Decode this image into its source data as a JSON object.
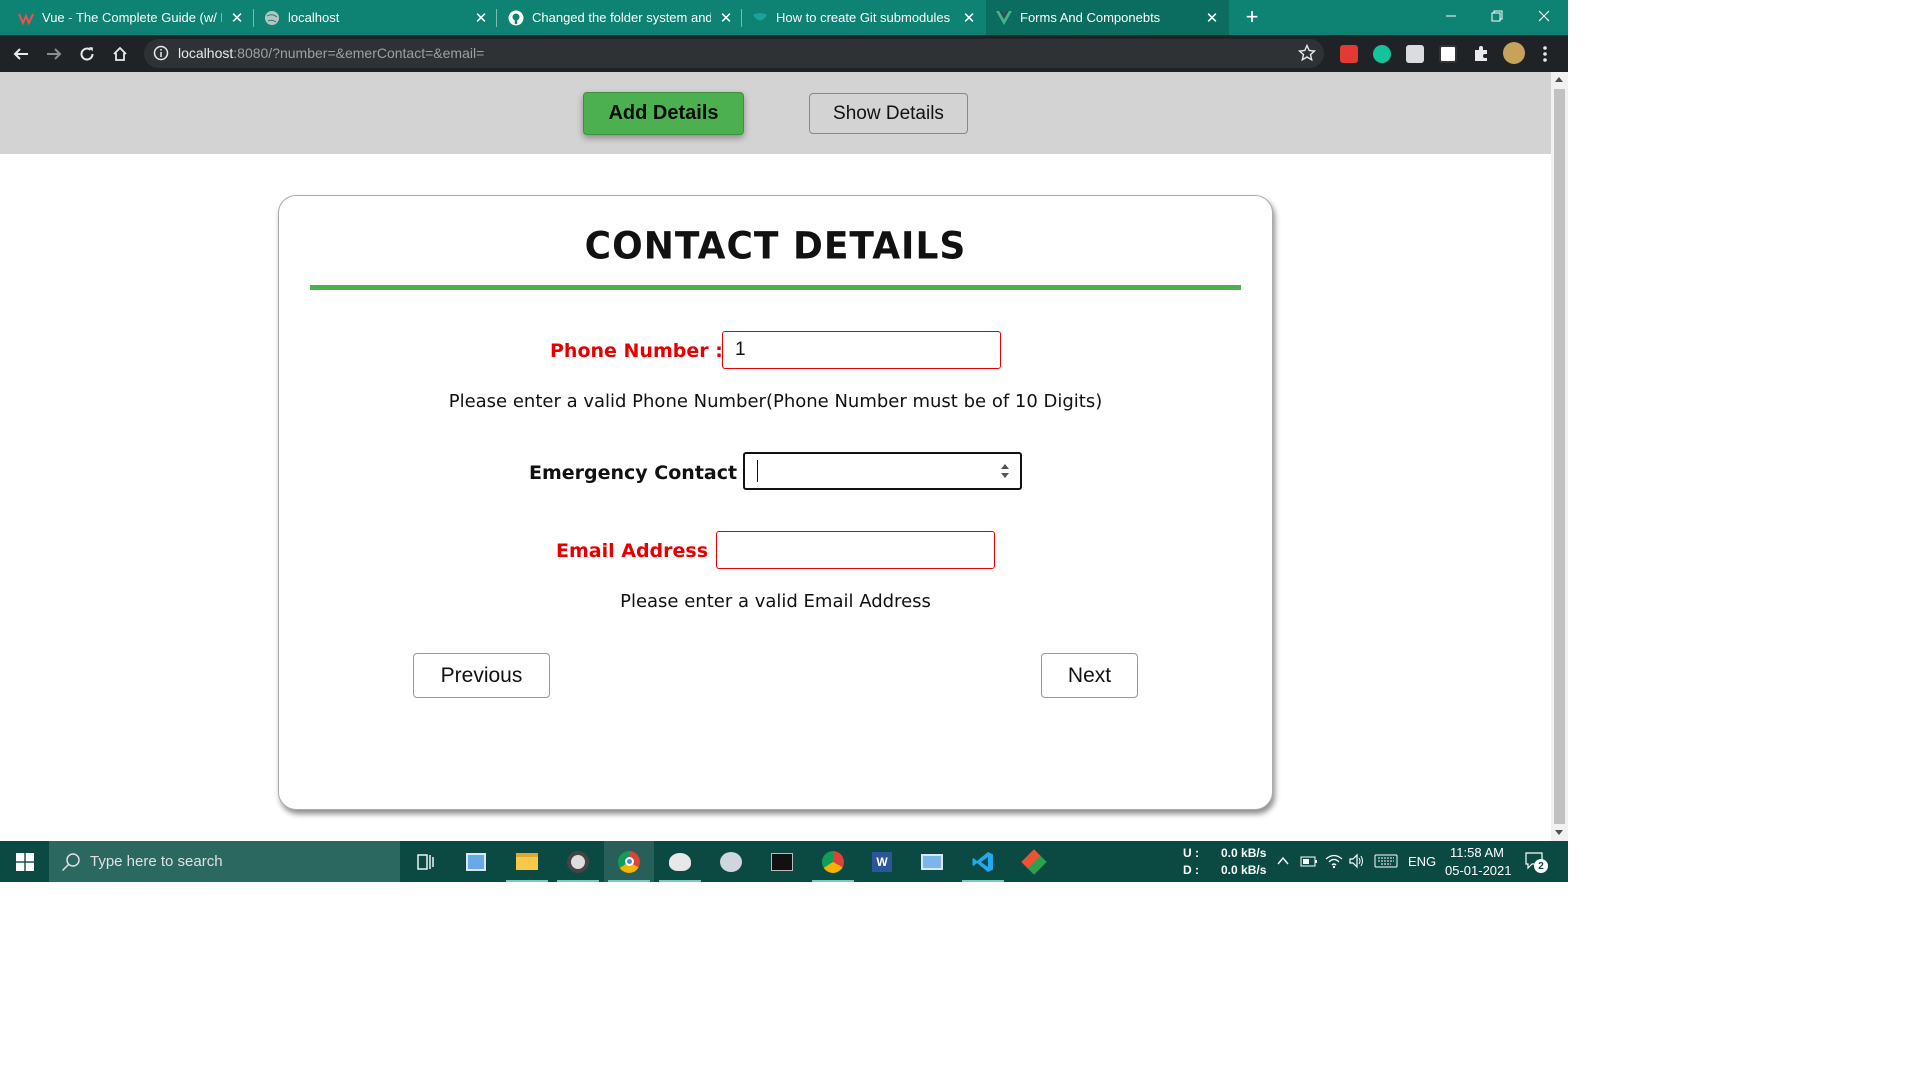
{
  "browser": {
    "tabs": [
      {
        "title": "Vue - The Complete Guide (w/ R",
        "favicon": "udemy-icon",
        "active": false
      },
      {
        "title": "localhost",
        "favicon": "globe-icon",
        "active": false
      },
      {
        "title": "Changed the folder system and a",
        "favicon": "github-icon",
        "active": false
      },
      {
        "title": "How to create Git submodules in",
        "favicon": "site-icon",
        "active": false
      },
      {
        "title": "Forms And Componebts",
        "favicon": "vue-icon",
        "active": true
      }
    ],
    "url_host": "localhost",
    "url_rest": ":8080/?number=&emerContact=&email="
  },
  "app": {
    "add_details_label": "Add Details",
    "show_details_label": "Show Details",
    "title": "CONTACT DETAILS",
    "phone": {
      "label": "Phone Number :",
      "value": "1",
      "error": "Please enter a valid Phone Number(Phone Number must be of 10 Digits)"
    },
    "emergency": {
      "label": "Emergency Contact :",
      "value": ""
    },
    "email": {
      "label": "Email Address :",
      "value": "",
      "error": "Please enter a valid Email Address"
    },
    "previous_label": "Previous",
    "next_label": "Next",
    "colors": {
      "accent_green": "#4caf50",
      "error_red": "#e60000"
    }
  },
  "taskbar": {
    "search_placeholder": "Type here to search",
    "net_up_label": "U :",
    "net_up_value": "0.0 kB/s",
    "net_down_label": "D :",
    "net_down_value": "0.0 kB/s",
    "language": "ENG",
    "time": "11:58 AM",
    "date": "05-01-2021",
    "notification_count": "2"
  }
}
